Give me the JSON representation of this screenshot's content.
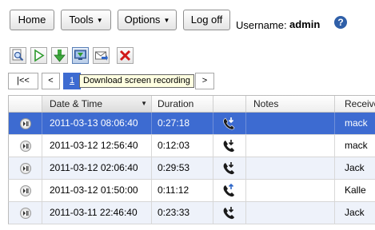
{
  "toolbar": {
    "home": "Home",
    "tools": "Tools",
    "options": "Options",
    "logoff": "Log off",
    "username_label": "Username:",
    "username": "admin",
    "help": "?"
  },
  "actions": {
    "icons": [
      "search-icon",
      "play-icon",
      "download-icon",
      "download-recording-icon",
      "send-icon",
      "delete-icon"
    ]
  },
  "pager": {
    "first": "|<<",
    "prev": "<",
    "current": "1",
    "next": ">",
    "tooltip": "Download screen recording"
  },
  "grid": {
    "columns": [
      "",
      "Date & Time",
      "Duration",
      "",
      "Notes",
      "Receiver"
    ],
    "rows": [
      {
        "datetime": "2011-03-13 08:06:40",
        "duration": "0:27:18",
        "direction": "incoming",
        "notes": "",
        "receiver": "mack",
        "selected": true
      },
      {
        "datetime": "2011-03-12 12:56:40",
        "duration": "0:12:03",
        "direction": "incoming",
        "notes": "",
        "receiver": "mack",
        "selected": false
      },
      {
        "datetime": "2011-03-12 02:06:40",
        "duration": "0:29:53",
        "direction": "incoming",
        "notes": "",
        "receiver": "Jack",
        "selected": false
      },
      {
        "datetime": "2011-03-12 01:50:00",
        "duration": "0:11:12",
        "direction": "outgoing",
        "notes": "",
        "receiver": "Kalle",
        "selected": false
      },
      {
        "datetime": "2011-03-11 22:46:40",
        "duration": "0:23:33",
        "direction": "incoming",
        "notes": "",
        "receiver": "Jack",
        "selected": false
      }
    ]
  },
  "colors": {
    "selection": "#3d6bd1",
    "alt_row": "#eef2fa",
    "tooltip_bg": "#ffffe1",
    "delete_red": "#d11a1a",
    "help_blue": "#2f5fa8"
  }
}
